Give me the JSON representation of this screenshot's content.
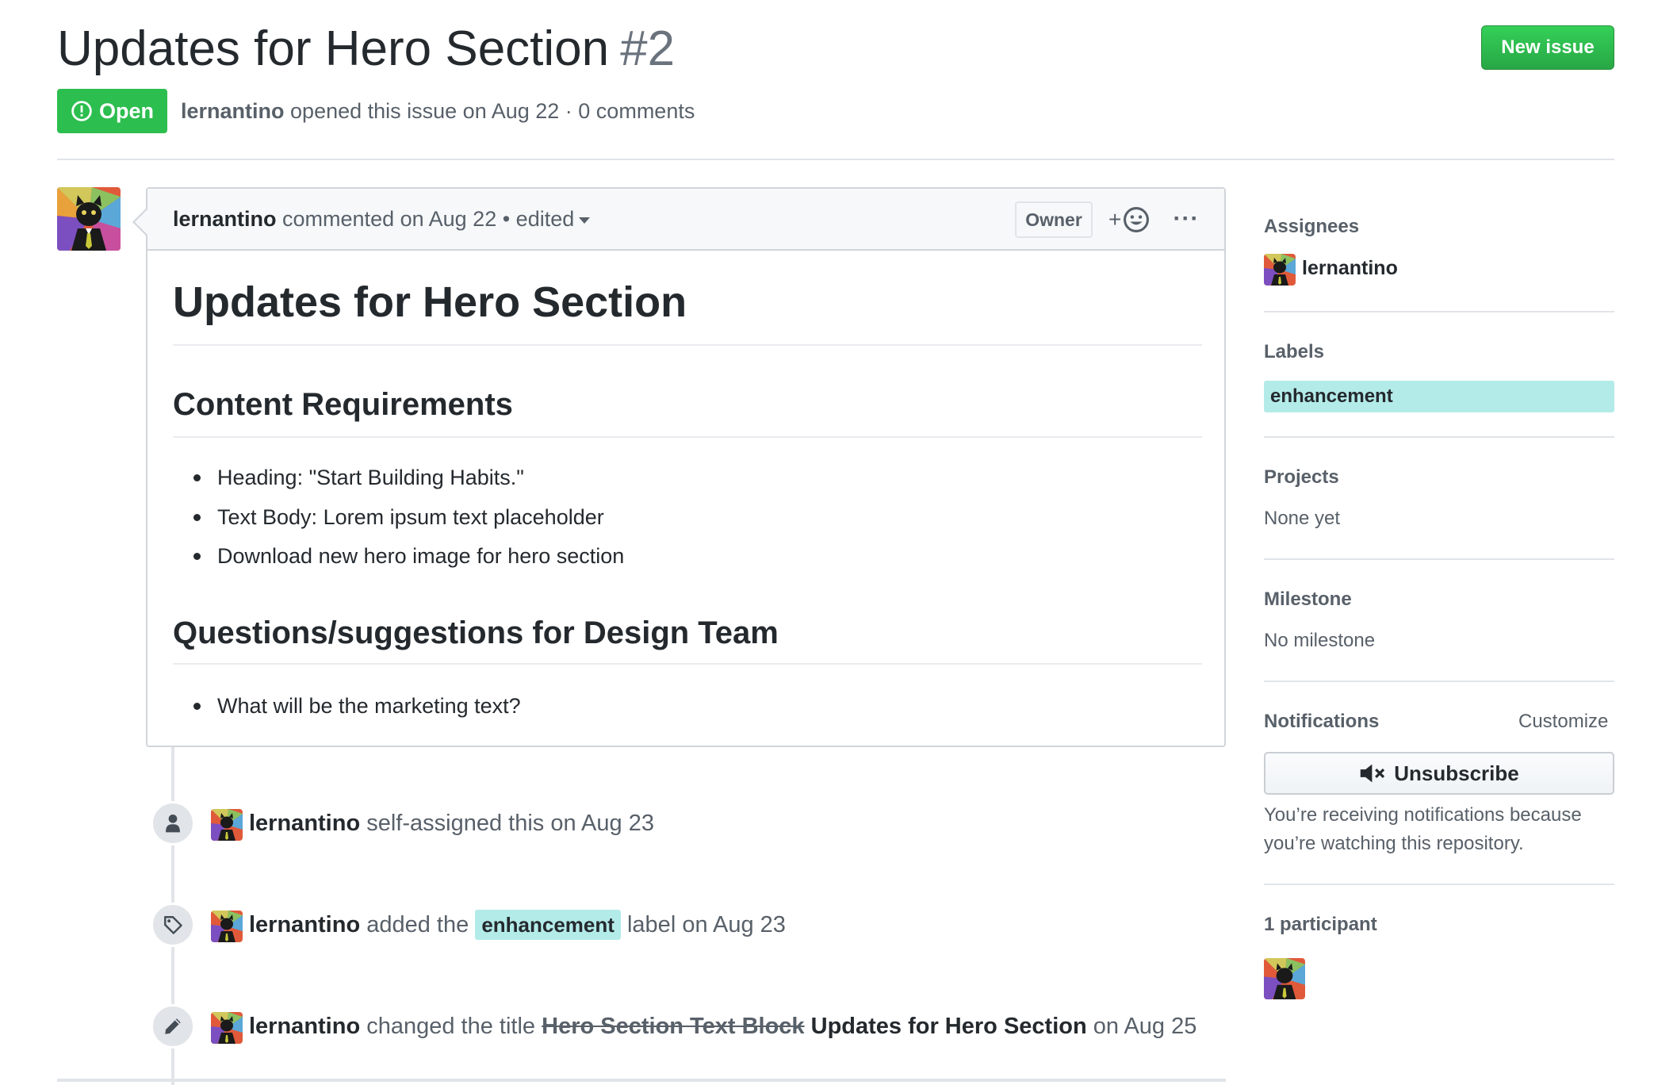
{
  "issue": {
    "title": "Updates for Hero Section",
    "number": "#2",
    "state": "Open",
    "author": "lernantino",
    "meta_rest": "opened this issue on Aug 22 · 0 comments",
    "new_issue_label": "New issue"
  },
  "comment": {
    "author": "lernantino",
    "meta": "commented on Aug 22 • edited",
    "role_badge": "Owner",
    "reaction_label": "+",
    "more_label": "···",
    "body": {
      "h1": "Updates for Hero Section",
      "section1_heading": "Content Requirements",
      "section1_items": [
        "Heading: \"Start Building Habits.\"",
        "Text Body: Lorem ipsum text placeholder",
        "Download new hero image for hero section"
      ],
      "section2_heading": "Questions/suggestions for Design Team",
      "section2_items": [
        "What will be the marketing text?"
      ]
    }
  },
  "timeline": [
    {
      "icon": "person-icon",
      "actor": "lernantino",
      "text": "self-assigned this on Aug 23"
    },
    {
      "icon": "tag-icon",
      "actor": "lernantino",
      "text_before": "added the",
      "label": "enhancement",
      "text_after": "label on Aug 23"
    },
    {
      "icon": "pencil-icon",
      "actor": "lernantino",
      "text_before": "changed the title",
      "old_title": "Hero Section Text Block",
      "new_title": "Updates for Hero Section",
      "text_after": "on Aug 25"
    }
  ],
  "sidebar": {
    "assignees_heading": "Assignees",
    "assignee": "lernantino",
    "labels_heading": "Labels",
    "label": "enhancement",
    "projects_heading": "Projects",
    "projects_value": "None yet",
    "milestone_heading": "Milestone",
    "milestone_value": "No milestone",
    "notifications_heading": "Notifications",
    "customize_label": "Customize",
    "unsubscribe_label": "Unsubscribe",
    "notifications_reason": "You’re receiving notifications because you’re watching this repository.",
    "participants_heading": "1 participant"
  },
  "colors": {
    "open_green": "#2cbe4e",
    "button_green": "#28a745",
    "label_enhancement": "#b3ebe8"
  }
}
